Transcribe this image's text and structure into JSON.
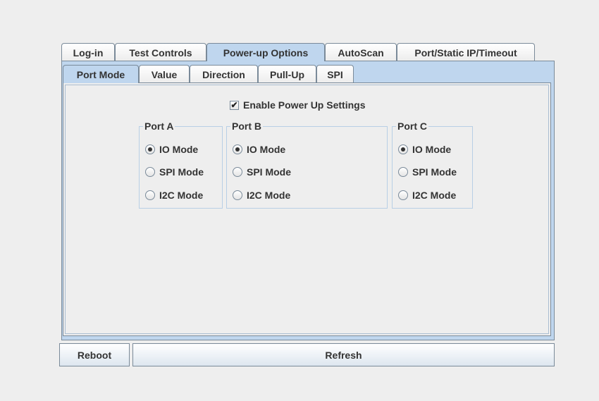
{
  "outer_tabs": [
    {
      "label": "Log-in",
      "selected": false
    },
    {
      "label": "Test Controls",
      "selected": false
    },
    {
      "label": "Power-up Options",
      "selected": true
    },
    {
      "label": "AutoScan",
      "selected": false
    },
    {
      "label": "Port/Static IP/Timeout",
      "selected": false
    }
  ],
  "inner_tabs": [
    {
      "label": "Port Mode",
      "selected": true
    },
    {
      "label": "Value",
      "selected": false
    },
    {
      "label": "Direction",
      "selected": false
    },
    {
      "label": "Pull-Up",
      "selected": false
    },
    {
      "label": "SPI",
      "selected": false
    }
  ],
  "enable_power_up": {
    "label": "Enable Power Up Settings",
    "checked": true,
    "check_glyph": "✔"
  },
  "ports": [
    {
      "title": "Port A",
      "options": [
        "IO Mode",
        "SPI Mode",
        "I2C Mode"
      ],
      "selected_index": 0
    },
    {
      "title": "Port B",
      "options": [
        "IO Mode",
        "SPI Mode",
        "I2C Mode"
      ],
      "selected_index": 0
    },
    {
      "title": "Port C",
      "options": [
        "IO Mode",
        "SPI Mode",
        "I2C Mode"
      ],
      "selected_index": 0
    }
  ],
  "buttons": {
    "reboot": "Reboot",
    "refresh": "Refresh"
  },
  "colors": {
    "background": "#eeeeee",
    "selected_tab": "#bfd6ee",
    "border": "#7a8a99"
  }
}
